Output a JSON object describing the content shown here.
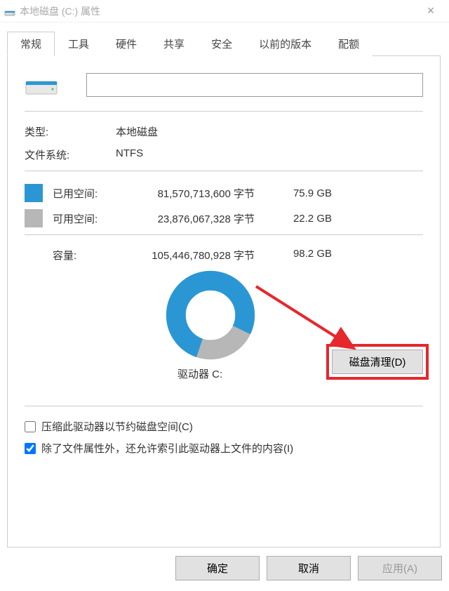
{
  "titlebar": {
    "title": "本地磁盘 (C:) 属性"
  },
  "tabs": {
    "general": "常规",
    "tools": "工具",
    "hardware": "硬件",
    "sharing": "共享",
    "security": "安全",
    "previous": "以前的版本",
    "quota": "配额"
  },
  "general": {
    "name_value": "",
    "type_label": "类型:",
    "type_value": "本地磁盘",
    "fs_label": "文件系统:",
    "fs_value": "NTFS",
    "used_label": "已用空间:",
    "used_bytes": "81,570,713,600 字节",
    "used_gb": "75.9 GB",
    "free_label": "可用空间:",
    "free_bytes": "23,876,067,328 字节",
    "free_gb": "22.2 GB",
    "capacity_label": "容量:",
    "capacity_bytes": "105,446,780,928 字节",
    "capacity_gb": "98.2 GB",
    "drive_caption": "驱动器 C:",
    "cleanup_label": "磁盘清理(D)",
    "compress_label": "压缩此驱动器以节约磁盘空间(C)",
    "index_label": "除了文件属性外，还允许索引此驱动器上文件的内容(I)"
  },
  "footer": {
    "ok": "确定",
    "cancel": "取消",
    "apply": "应用(A)"
  },
  "chart_data": {
    "type": "pie",
    "title": "驱动器 C:",
    "categories": [
      "已用空间",
      "可用空间"
    ],
    "values": [
      75.9,
      22.2
    ],
    "series": [
      {
        "name": "已用空间",
        "bytes": 81570713600,
        "gb": 75.9,
        "color": "#2a97d4"
      },
      {
        "name": "可用空间",
        "bytes": 23876067328,
        "gb": 22.2,
        "color": "#b7b7b7"
      }
    ],
    "total_gb": 98.2,
    "total_bytes": 105446780928
  },
  "colors": {
    "used": "#2a97d4",
    "free": "#b7b7b7",
    "highlight": "#e6272c"
  }
}
